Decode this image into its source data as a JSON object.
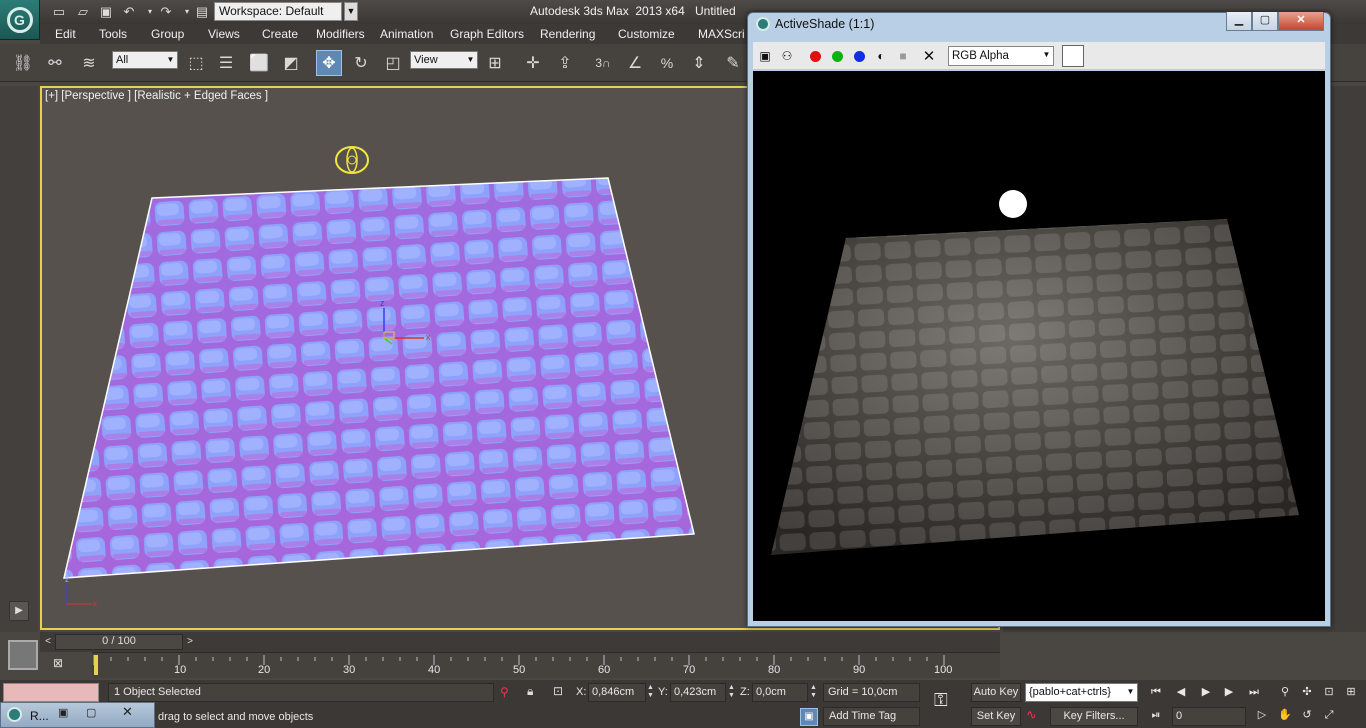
{
  "titlebar": {
    "app_title": "Autodesk 3ds Max  2013 x64",
    "doc_title": "Untitled",
    "workspace": "Workspace: Default"
  },
  "menu": [
    "Edit",
    "Tools",
    "Group",
    "Views",
    "Create",
    "Modifiers",
    "Animation",
    "Graph Editors",
    "Rendering",
    "Customize",
    "MAXScri"
  ],
  "toolbar": {
    "selection_filter": "All",
    "reference_coord": "View",
    "icons": [
      "link-icon",
      "unlink-icon",
      "bind-space-warp-icon",
      "select-object-icon",
      "select-by-name-icon",
      "rectangle-region-icon",
      "window-crossing-icon",
      "move-icon",
      "rotate-icon",
      "scale-icon",
      "pivot-icon",
      "mirror-icon",
      "align-icon",
      "snap-3d-icon",
      "angle-snap-icon",
      "percent-snap-icon",
      "spinner-snap-icon"
    ],
    "snap_label": "3"
  },
  "viewport": {
    "label": "[+] [Perspective ] [Realistic + Edged Faces ]"
  },
  "activeshade": {
    "title": "ActiveShade (1:1)",
    "channel": "RGB Alpha",
    "swatch_color": "#ffffff"
  },
  "timeline": {
    "position": "0 / 100",
    "current_frame_fraction": 0.0,
    "ticks": [
      "10",
      "20",
      "30",
      "40",
      "50",
      "60",
      "70",
      "80",
      "90",
      "100"
    ]
  },
  "status": {
    "selection": "1 Object Selected",
    "prompt": "drag to select and move objects",
    "x_label": "X:",
    "x_value": "0,846cm",
    "y_label": "Y:",
    "y_value": "0,423cm",
    "z_label": "Z:",
    "z_value": "0,0cm",
    "grid": "Grid = 10,0cm",
    "add_time_tag": "Add Time Tag",
    "auto_key": "Auto Key",
    "set_key": "Set Key",
    "key_set": "{pablo+cat+ctrls}",
    "key_filters": "Key Filters...",
    "frame": "0"
  },
  "taskbar": {
    "label": "R..."
  },
  "colors": {
    "viewport_border": "#e8d050",
    "active_tool": "#5f88b3",
    "normal_map_base": "#8a8cf2"
  }
}
